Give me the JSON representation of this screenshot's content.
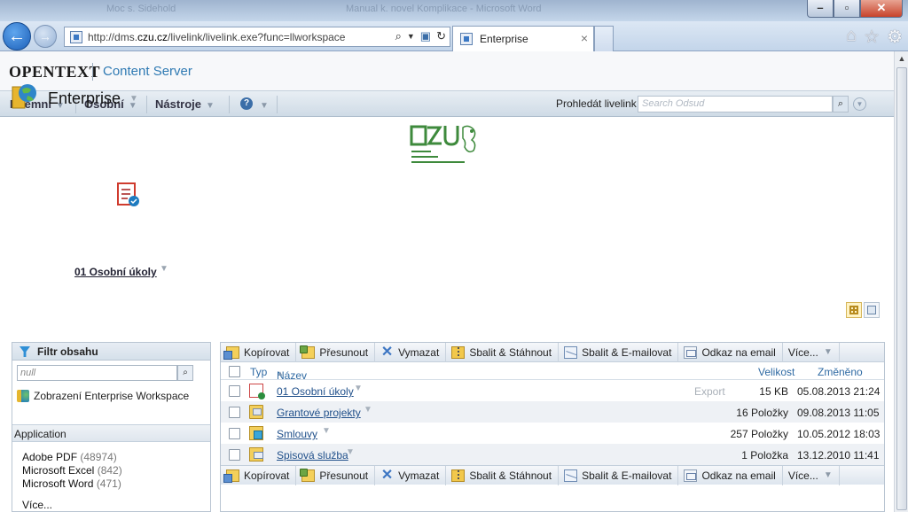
{
  "browser": {
    "url_prefix": "http://dms.",
    "url_domain": "czu.cz",
    "url_path": "/livelink/livelink.exe?func=llworkspace",
    "tab_title": "Enterprise",
    "title_ghost_1": "Moc s. Sidehold",
    "title_ghost_2": "Manual k. novel Komplikace - Microsoft Word"
  },
  "header": {
    "logo": "OPENTEXT",
    "product": "Content Server"
  },
  "menu": {
    "items": [
      "Firemní",
      "Osobní",
      "Nástroje"
    ],
    "help": "?",
    "search_label": "Prohledát livelink",
    "search_placeholder": "Search Odsud"
  },
  "workspace": {
    "title": "Enterprise",
    "featured_item": "01 Osobní úkoly"
  },
  "filter": {
    "title": "Filtr obsahu",
    "input_placeholder": "null",
    "workspace_link": "Zobrazení Enterprise Workspace",
    "section": "Application",
    "facets": [
      {
        "label": "Adobe PDF",
        "count": "(48974)"
      },
      {
        "label": "Microsoft Excel",
        "count": "(842)"
      },
      {
        "label": "Microsoft Word",
        "count": "(471)"
      }
    ],
    "more": "Více..."
  },
  "toolbar": {
    "copy": "Kopírovat",
    "move": "Přesunout",
    "delete": "Vymazat",
    "zip_download": "Sbalit & Stáhnout",
    "zip_email": "Sbalit & E-mailovat",
    "email_link": "Odkaz na email",
    "more": "Více..."
  },
  "table": {
    "columns": {
      "type": "Typ",
      "name": "Název",
      "size": "Velikost",
      "modified": "Změněno"
    },
    "rows": [
      {
        "name": "01 Osobní úkoly",
        "export": "Export",
        "size": "15 KB",
        "modified": "05.08.2013 21:24"
      },
      {
        "name": "Grantové projekty",
        "export": "",
        "size": "16 Položky",
        "modified": "09.08.2013 11:05"
      },
      {
        "name": "Smlouvy",
        "export": "",
        "size": "257 Položky",
        "modified": "10.05.2012 18:03"
      },
      {
        "name": "Spisová služba",
        "export": "",
        "size": "1 Položka",
        "modified": "13.12.2010 11:41"
      }
    ]
  }
}
